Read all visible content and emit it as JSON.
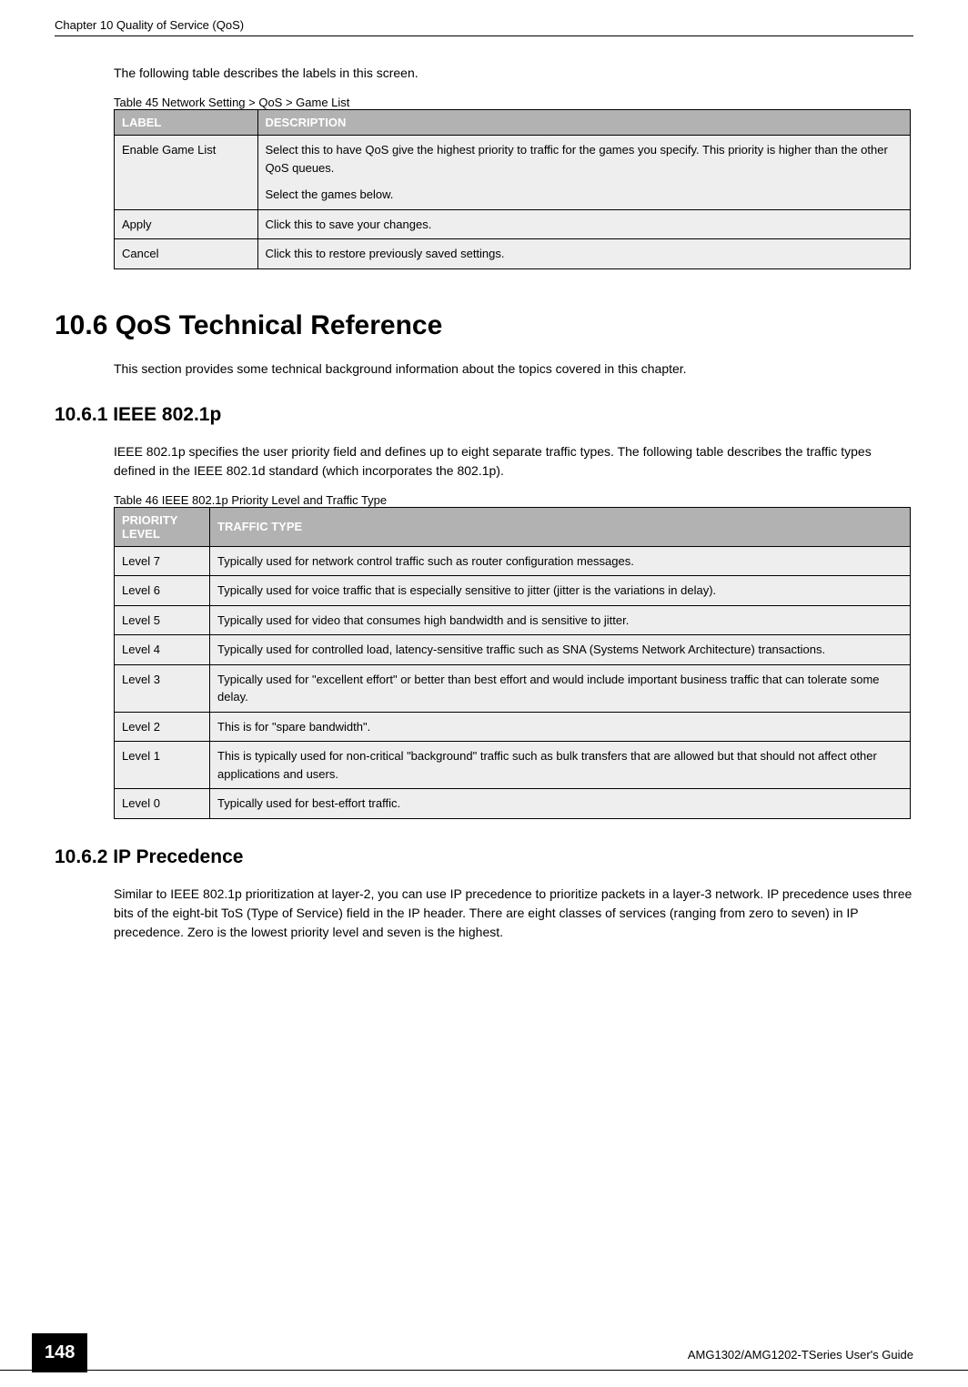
{
  "header": {
    "chapter": "Chapter 10 Quality of Service (QoS)"
  },
  "intro_text": "The following table describes the labels in this screen.",
  "table45": {
    "caption": "Table 45   Network Setting > QoS > Game List",
    "headers": {
      "label": "LABEL",
      "description": "DESCRIPTION"
    },
    "rows": [
      {
        "label": "Enable Game List",
        "desc_line1": "Select this to have QoS give the highest priority to traffic for the games you specify. This priority is higher than the other QoS queues.",
        "desc_line2": "Select the games below."
      },
      {
        "label": "Apply",
        "desc_line1": "Click this to save your changes."
      },
      {
        "label": "Cancel",
        "desc_line1": "Click this to restore previously saved settings."
      }
    ]
  },
  "section_10_6": {
    "title": "10.6  QoS Technical Reference",
    "text": "This section provides some technical background information about the topics covered in this chapter."
  },
  "section_10_6_1": {
    "title": "10.6.1  IEEE 802.1p",
    "text": "IEEE 802.1p specifies the user priority field and defines up to eight separate traffic types. The following table describes the traffic types defined in the IEEE 802.1d standard (which incorporates the 802.1p)."
  },
  "table46": {
    "caption": "Table 46   IEEE 802.1p Priority Level and Traffic Type",
    "headers": {
      "priority": "PRIORITY LEVEL",
      "traffic": "TRAFFIC TYPE"
    },
    "rows": [
      {
        "level": "Level 7",
        "desc": "Typically used for network control traffic such as router configuration messages."
      },
      {
        "level": "Level 6",
        "desc": "Typically used for voice traffic that is especially sensitive to jitter (jitter is the variations in delay)."
      },
      {
        "level": "Level 5",
        "desc": "Typically used for video that consumes high bandwidth and is sensitive to jitter."
      },
      {
        "level": "Level 4",
        "desc": "Typically used for controlled load, latency-sensitive traffic such as SNA (Systems Network Architecture) transactions."
      },
      {
        "level": "Level 3",
        "desc": "Typically used for \"excellent effort\" or better than best effort and would include important business traffic that can tolerate some delay."
      },
      {
        "level": "Level 2",
        "desc": "This is for \"spare bandwidth\"."
      },
      {
        "level": "Level 1",
        "desc": "This is typically used for non-critical \"background\" traffic such as bulk transfers that are allowed but that should not affect other applications and users."
      },
      {
        "level": "Level 0",
        "desc": "Typically used for best-effort traffic."
      }
    ]
  },
  "section_10_6_2": {
    "title": "10.6.2  IP Precedence",
    "text": "Similar to IEEE 802.1p prioritization at layer-2, you can use IP precedence to prioritize packets in a layer-3 network. IP precedence uses three bits of the eight-bit ToS (Type of Service) field in the IP header. There are eight classes of services (ranging from zero to seven) in IP precedence. Zero is the lowest priority level and seven is the highest."
  },
  "footer": {
    "page_number": "148",
    "guide_name": "AMG1302/AMG1202-TSeries User's Guide"
  }
}
